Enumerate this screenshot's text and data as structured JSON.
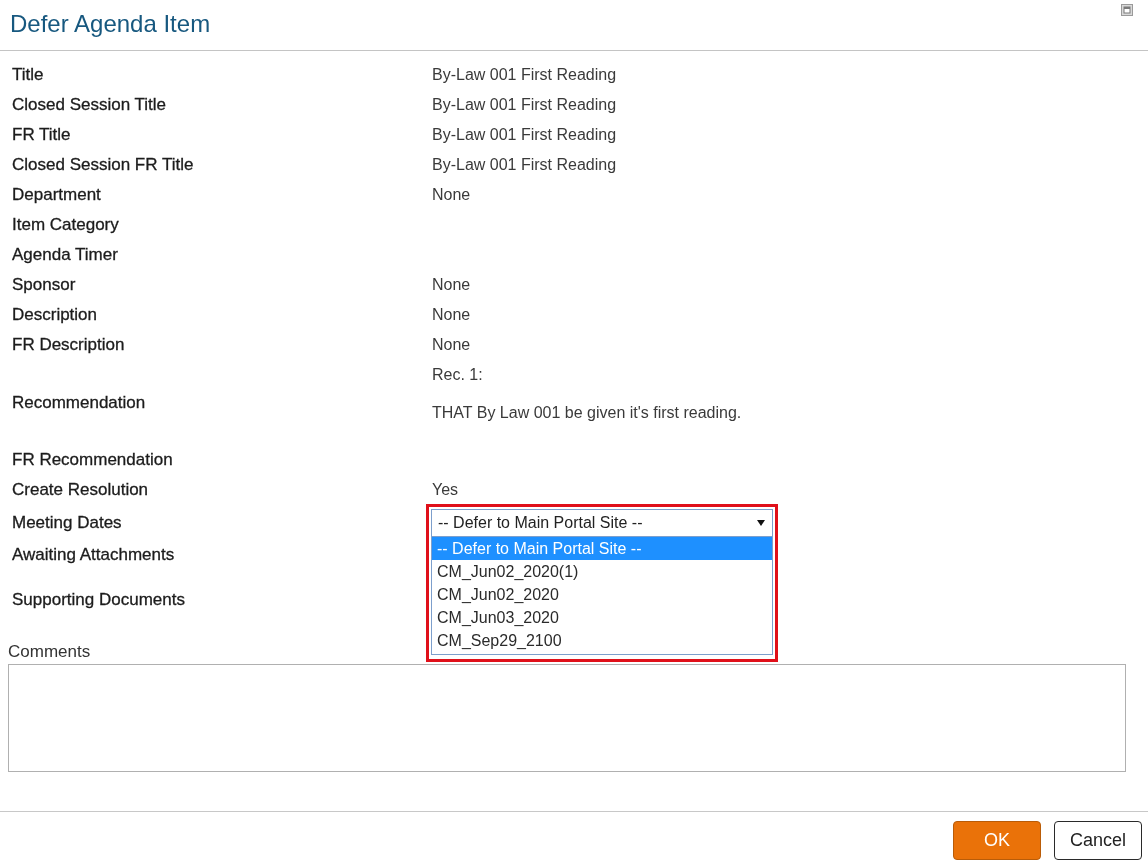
{
  "dialog": {
    "title": "Defer Agenda Item"
  },
  "fields": [
    {
      "label": "Title",
      "kind": "text",
      "value": "By-Law 001 First Reading"
    },
    {
      "label": "Closed Session Title",
      "kind": "text",
      "value": "By-Law 001 First Reading"
    },
    {
      "label": "FR Title",
      "kind": "text",
      "value": "By-Law 001 First Reading"
    },
    {
      "label": "Closed Session FR Title",
      "kind": "text",
      "value": "By-Law 001 First Reading"
    },
    {
      "label": "Department",
      "kind": "text",
      "value": "None"
    },
    {
      "label": "Item Category",
      "kind": "text"
    },
    {
      "label": "Agenda Timer",
      "kind": "text"
    },
    {
      "label": "Sponsor",
      "kind": "text",
      "value": "None"
    },
    {
      "label": "Description",
      "kind": "text",
      "value": "None"
    },
    {
      "label": "FR Description",
      "kind": "text",
      "value": "None"
    },
    {
      "label": "Recommendation",
      "kind": "recommendation",
      "heading": "Rec. 1:",
      "value": "THAT By Law 001 be given it's first reading."
    },
    {
      "label": "FR Recommendation",
      "kind": "text"
    },
    {
      "label": "Create Resolution",
      "kind": "text",
      "value": "Yes"
    },
    {
      "label": "Meeting Dates",
      "kind": "dropdown",
      "dropdown": {
        "value": "-- Defer to Main Portal Site --",
        "expanded": true,
        "highlighted": true,
        "options": [
          {
            "label": "-- Defer to Main Portal Site --",
            "selected": true
          },
          {
            "label": "CM_Jun02_2020(1)",
            "selected": false
          },
          {
            "label": "CM_Jun02_2020",
            "selected": false
          },
          {
            "label": "CM_Jun03_2020",
            "selected": false
          },
          {
            "label": "CM_Sep29_2100",
            "selected": false
          }
        ]
      }
    },
    {
      "label": "Awaiting Attachments",
      "kind": "text"
    },
    {
      "label": "Supporting Documents",
      "kind": "documents"
    }
  ],
  "comments": {
    "label": "Comments"
  },
  "buttons": [
    {
      "label": "OK",
      "kind": "primary"
    },
    {
      "label": "Cancel",
      "kind": "secondary"
    }
  ]
}
